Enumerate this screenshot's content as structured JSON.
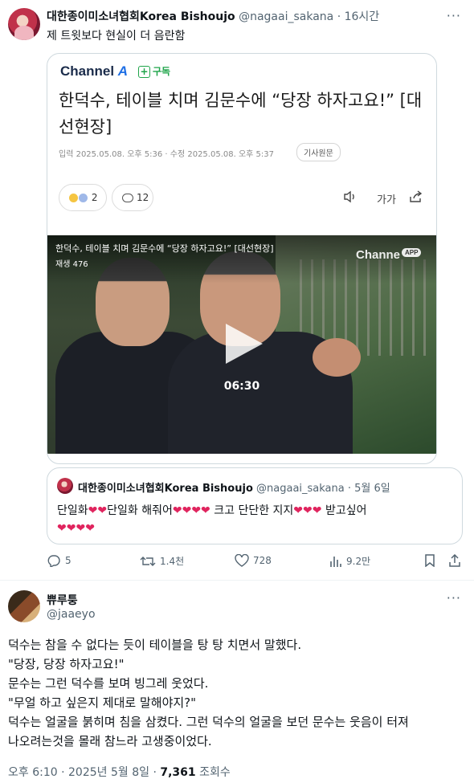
{
  "tweet1": {
    "author_name": "대한종이미소녀협회Korea Bishoujo",
    "handle": "@nagaai_sakana",
    "separator": "·",
    "time": "16시간",
    "more": "···",
    "text": "제 트윗보다 현실이 더 음란함"
  },
  "card": {
    "logo": "Channel",
    "logo_mark": "A",
    "subscribe": "구독",
    "headline": "한덕수, 테이블 치며 김문수에 “당장 하자고요!” [대선현장]",
    "date_text": "입력 2025.05.08. 오후 5:36 · 수정 2025.05.08. 오후 5:37",
    "original_button": "기사원문",
    "reactions_count": "2",
    "comments_count": "12",
    "text_size_label": "가가"
  },
  "video": {
    "title": "한덕수, 테이블 치며 김문수에 “당장 하자고요!” [대선현장]",
    "plays": "재생 476",
    "logo": "Channe",
    "app_badge": "APP",
    "duration": "06:30"
  },
  "quote": {
    "author_name": "대한종이미소녀협회Korea Bishoujo",
    "handle": "@nagaai_sakana",
    "separator": "·",
    "date": "5월 6일",
    "t1": "단일화",
    "t2": "단일화 해줘어",
    "t3": "크고 단단한 지지",
    "t4": "받고싶어",
    "heart": "❤"
  },
  "actions": {
    "replies": "5",
    "retweets": "1.4천",
    "likes": "728",
    "views": "9.2만"
  },
  "tweet2": {
    "author_name": "쀼루퉁",
    "handle": "@jaaeyo",
    "more": "···",
    "lines": [
      "덕수는 참을 수 없다는 듯이 테이블을 탕 탕 치면서 말했다.",
      "\"당장, 당장 하자고요!\"",
      "문수는 그런 덕수를 보며 빙그레 웃었다.",
      "\"무얼 하고 싶은지 제대로 말해야지?\"",
      "덕수는 얼굴을 붉히며 침을 삼켰다. 그런 덕수의 얼굴을 보던 문수는 웃음이 터져",
      "나오려는것을 몰래 참느라 고생중이었다."
    ],
    "time": "오후 6:10",
    "separator": "·",
    "date": "2025년 5월 8일",
    "views_count": "7,361",
    "views_label": "조회수"
  },
  "colors": {
    "text": "#0f1419",
    "muted": "#536471",
    "border": "#cfd9de",
    "heart": "#e0245e",
    "subscribe_green": "#1fa44a",
    "channel_a_blue": "#1f6fe5"
  },
  "icons": [
    "more-icon",
    "subscribe-plus-icon",
    "reaction-emoji-icon",
    "comment-icon",
    "speaker-icon",
    "share-icon",
    "play-icon",
    "reply-icon",
    "retweet-icon",
    "like-icon",
    "views-icon",
    "bookmark-icon",
    "upload-icon"
  ]
}
